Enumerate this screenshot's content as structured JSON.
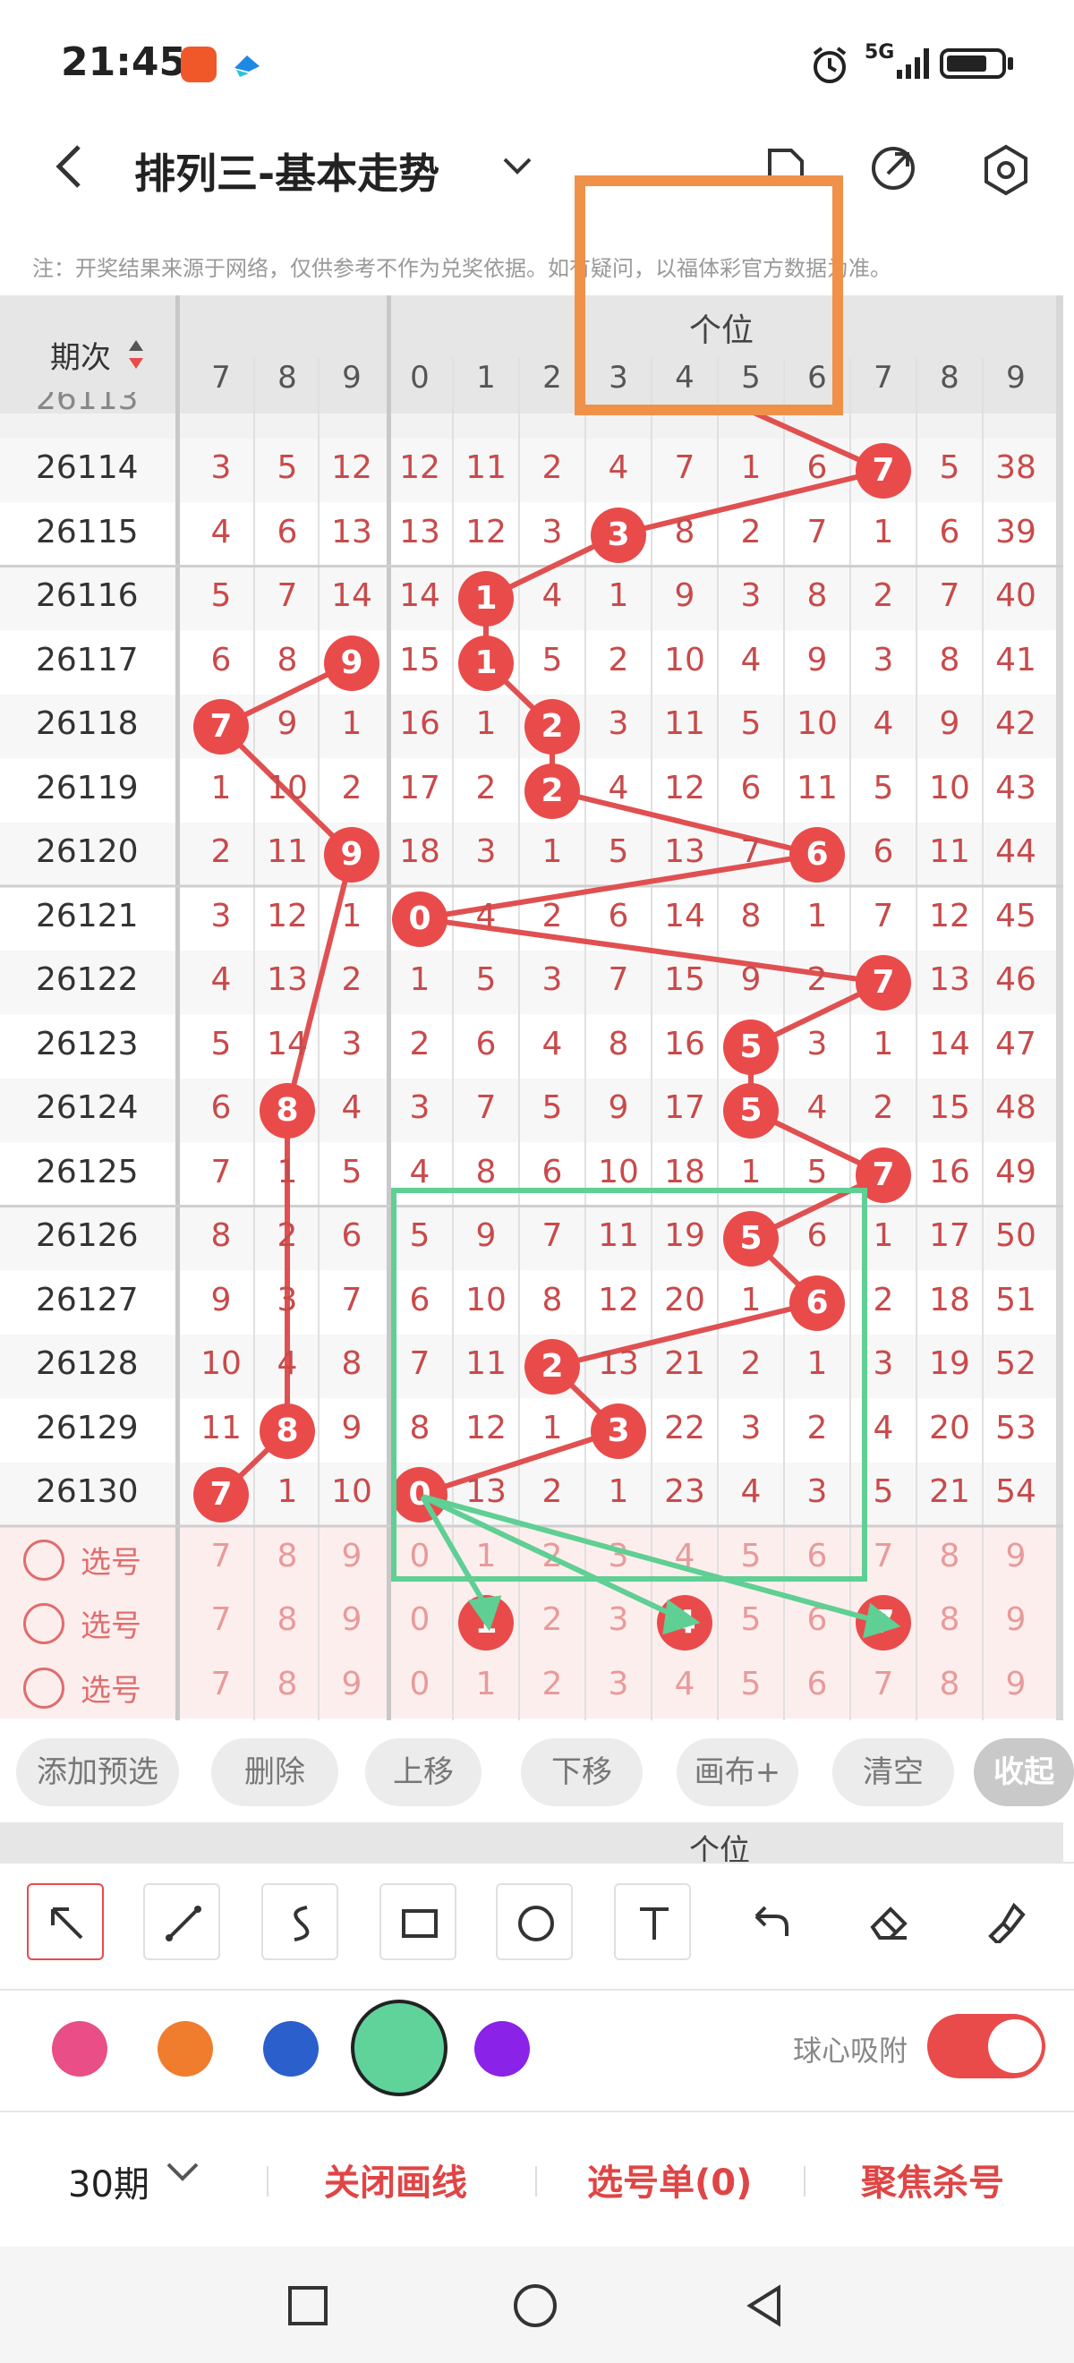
{
  "status_bar": {
    "time": "21:45",
    "network": "5G"
  },
  "header": {
    "title": "排列三-基本走势"
  },
  "disclaimer": "注：开奖结果来源于网络，仅供参考不作为兑奖依据。如有疑问，以福体彩官方数据为准。",
  "chart": {
    "issue_header": "期次",
    "unit_header": "个位",
    "left_col_numbers": [
      "7",
      "8",
      "9"
    ],
    "unit_col_numbers": [
      "0",
      "1",
      "2",
      "3",
      "4",
      "5",
      "6",
      "7",
      "8",
      "9"
    ],
    "partial_row_issue": "26113",
    "rows": [
      {
        "issue": "26114",
        "left": [
          "3",
          "5",
          "12"
        ],
        "unit": [
          "12",
          "11",
          "2",
          "4",
          "7",
          "1",
          "6",
          "7",
          "5",
          "38"
        ],
        "ball_col": 7
      },
      {
        "issue": "26115",
        "left": [
          "4",
          "6",
          "13"
        ],
        "unit": [
          "13",
          "12",
          "3",
          "3",
          "8",
          "2",
          "7",
          "1",
          "6",
          "39"
        ],
        "ball_col": 3
      },
      {
        "issue": "26116",
        "left": [
          "5",
          "7",
          "14"
        ],
        "unit": [
          "14",
          "1",
          "4",
          "1",
          "9",
          "3",
          "8",
          "2",
          "7",
          "40"
        ],
        "ball_col": 1
      },
      {
        "issue": "26117",
        "left": [
          "6",
          "8",
          "9"
        ],
        "unit": [
          "15",
          "1",
          "5",
          "2",
          "10",
          "4",
          "9",
          "3",
          "8",
          "41"
        ],
        "ball_col": 1,
        "left_ball": 2
      },
      {
        "issue": "26118",
        "left": [
          "7",
          "9",
          "1"
        ],
        "unit": [
          "16",
          "1",
          "2",
          "3",
          "11",
          "5",
          "10",
          "4",
          "9",
          "42"
        ],
        "ball_col": 2,
        "left_ball": 0
      },
      {
        "issue": "26119",
        "left": [
          "1",
          "10",
          "2"
        ],
        "unit": [
          "17",
          "2",
          "2",
          "4",
          "12",
          "6",
          "11",
          "5",
          "10",
          "43"
        ],
        "ball_col": 2
      },
      {
        "issue": "26120",
        "left": [
          "2",
          "11",
          "9"
        ],
        "unit": [
          "18",
          "3",
          "1",
          "5",
          "13",
          "7",
          "6",
          "6",
          "11",
          "44"
        ],
        "ball_col": 6,
        "left_ball": 2
      },
      {
        "issue": "26121",
        "left": [
          "3",
          "12",
          "1"
        ],
        "unit": [
          "0",
          "4",
          "2",
          "6",
          "14",
          "8",
          "1",
          "7",
          "12",
          "45"
        ],
        "ball_col": 0
      },
      {
        "issue": "26122",
        "left": [
          "4",
          "13",
          "2"
        ],
        "unit": [
          "1",
          "5",
          "3",
          "7",
          "15",
          "9",
          "2",
          "7",
          "13",
          "46"
        ],
        "ball_col": 7
      },
      {
        "issue": "26123",
        "left": [
          "5",
          "14",
          "3"
        ],
        "unit": [
          "2",
          "6",
          "4",
          "8",
          "16",
          "5",
          "3",
          "1",
          "14",
          "47"
        ],
        "ball_col": 5
      },
      {
        "issue": "26124",
        "left": [
          "6",
          "8",
          "4"
        ],
        "unit": [
          "3",
          "7",
          "5",
          "9",
          "17",
          "5",
          "4",
          "2",
          "15",
          "48"
        ],
        "ball_col": 5,
        "left_ball": 1
      },
      {
        "issue": "26125",
        "left": [
          "7",
          "1",
          "5"
        ],
        "unit": [
          "4",
          "8",
          "6",
          "10",
          "18",
          "1",
          "5",
          "7",
          "16",
          "49"
        ],
        "ball_col": 7
      },
      {
        "issue": "26126",
        "left": [
          "8",
          "2",
          "6"
        ],
        "unit": [
          "5",
          "9",
          "7",
          "11",
          "19",
          "5",
          "6",
          "1",
          "17",
          "50"
        ],
        "ball_col": 5
      },
      {
        "issue": "26127",
        "left": [
          "9",
          "3",
          "7"
        ],
        "unit": [
          "6",
          "10",
          "8",
          "12",
          "20",
          "1",
          "6",
          "2",
          "18",
          "51"
        ],
        "ball_col": 6
      },
      {
        "issue": "26128",
        "left": [
          "10",
          "4",
          "8"
        ],
        "unit": [
          "7",
          "11",
          "2",
          "13",
          "21",
          "2",
          "1",
          "3",
          "19",
          "52"
        ],
        "ball_col": 2
      },
      {
        "issue": "26129",
        "left": [
          "11",
          "8",
          "9"
        ],
        "unit": [
          "8",
          "12",
          "1",
          "3",
          "22",
          "3",
          "2",
          "4",
          "20",
          "53"
        ],
        "ball_col": 3,
        "left_ball": 1
      },
      {
        "issue": "26130",
        "left": [
          "7",
          "1",
          "10"
        ],
        "unit": [
          "0",
          "13",
          "2",
          "1",
          "23",
          "4",
          "3",
          "5",
          "21",
          "54"
        ],
        "ball_col": 0,
        "left_ball": 0
      }
    ],
    "pick_rows": [
      {
        "label": "选号",
        "left": [
          "7",
          "8",
          "9"
        ],
        "unit": [
          "0",
          "1",
          "2",
          "3",
          "4",
          "5",
          "6",
          "7",
          "8",
          "9"
        ],
        "ball_col": -1
      },
      {
        "label": "选号",
        "left": [
          "7",
          "8",
          "9"
        ],
        "unit": [
          "0",
          "1",
          "2",
          "3",
          "4",
          "5",
          "6",
          "7",
          "8",
          "9"
        ],
        "balls": [
          1,
          4,
          7
        ]
      },
      {
        "label": "选号",
        "left": [
          "7",
          "8",
          "9"
        ],
        "unit": [
          "0",
          "1",
          "2",
          "3",
          "4",
          "5",
          "6",
          "7",
          "8",
          "9"
        ],
        "ball_col": -1
      }
    ]
  },
  "actions": [
    "添加预选",
    "删除",
    "上移",
    "下移",
    "画布+",
    "清空",
    "收起"
  ],
  "tools": [
    "arrow-tool",
    "line-tool",
    "curve-tool",
    "rectangle-tool",
    "circle-tool",
    "text-tool",
    "undo-tool",
    "eraser-tool",
    "clear-brush-tool"
  ],
  "colors": [
    "#e94e86",
    "#f07d2d",
    "#2a5fcc",
    "#5fd39a",
    "#8a22e8"
  ],
  "selected_color": "#5fd39a",
  "snap_label": "球心吸附",
  "snap_enabled": true,
  "bottom": {
    "period": "30期",
    "close_lines": "关闭画线",
    "pick_list": "选号单(0)",
    "focus_kill": "聚焦杀号"
  }
}
